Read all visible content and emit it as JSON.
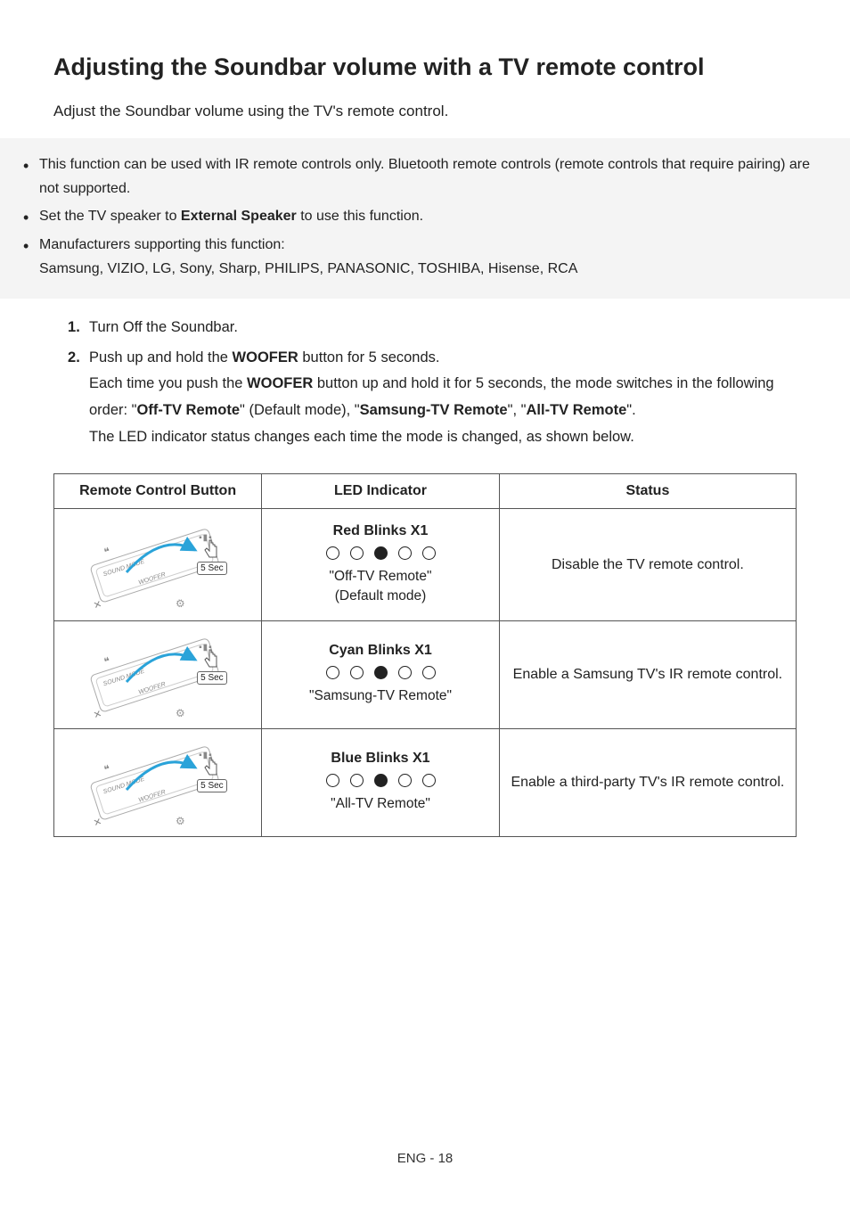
{
  "heading": "Adjusting the Soundbar volume with a TV remote control",
  "intro": "Adjust the Soundbar volume using the TV's remote control.",
  "notes": {
    "item1": "This function can be used with IR remote controls only. Bluetooth remote controls (remote controls that require pairing) are not supported.",
    "item2_pre": "Set the TV speaker to ",
    "item2_bold": "External Speaker",
    "item2_post": " to use this function.",
    "item3_line1": "Manufacturers supporting this function:",
    "item3_line2": "Samsung, VIZIO, LG, Sony, Sharp, PHILIPS, PANASONIC, TOSHIBA, Hisense, RCA"
  },
  "steps": {
    "s1": "Turn Off the Soundbar.",
    "s2_pre": "Push up and hold the ",
    "s2_bold1": "WOOFER",
    "s2_post": " button for 5 seconds.",
    "s2_line2_pre": "Each time you push the ",
    "s2_line2_bold1": "WOOFER",
    "s2_line2_mid": " button up and hold it for 5 seconds, the mode switches in the following order: \"",
    "s2_line2_bold2": "Off-TV Remote",
    "s2_line2_mid2": "\" (Default mode), \"",
    "s2_line2_bold3": "Samsung-TV Remote",
    "s2_line2_mid3": "\", \"",
    "s2_line2_bold4": "All-TV Remote",
    "s2_line2_end": "\".",
    "s2_line3": "The LED indicator status changes each time the mode is changed, as shown below."
  },
  "table": {
    "h1": "Remote Control Button",
    "h2": "LED Indicator",
    "h3": "Status",
    "remote_sec": "5 Sec",
    "remote_sound": "SOUND MODE",
    "remote_woofer": "WOOFER",
    "rows": [
      {
        "blink": "Red Blinks X1",
        "label_l1": "\"Off-TV Remote\"",
        "label_l2": "(Default mode)",
        "status": "Disable the TV remote control."
      },
      {
        "blink": "Cyan Blinks X1",
        "label_l1": "\"Samsung-TV Remote\"",
        "label_l2": "",
        "status": "Enable a Samsung TV's IR remote control."
      },
      {
        "blink": "Blue Blinks X1",
        "label_l1": "\"All-TV Remote\"",
        "label_l2": "",
        "status": "Enable a third-party TV's IR remote control."
      }
    ]
  },
  "footer": "ENG - 18"
}
